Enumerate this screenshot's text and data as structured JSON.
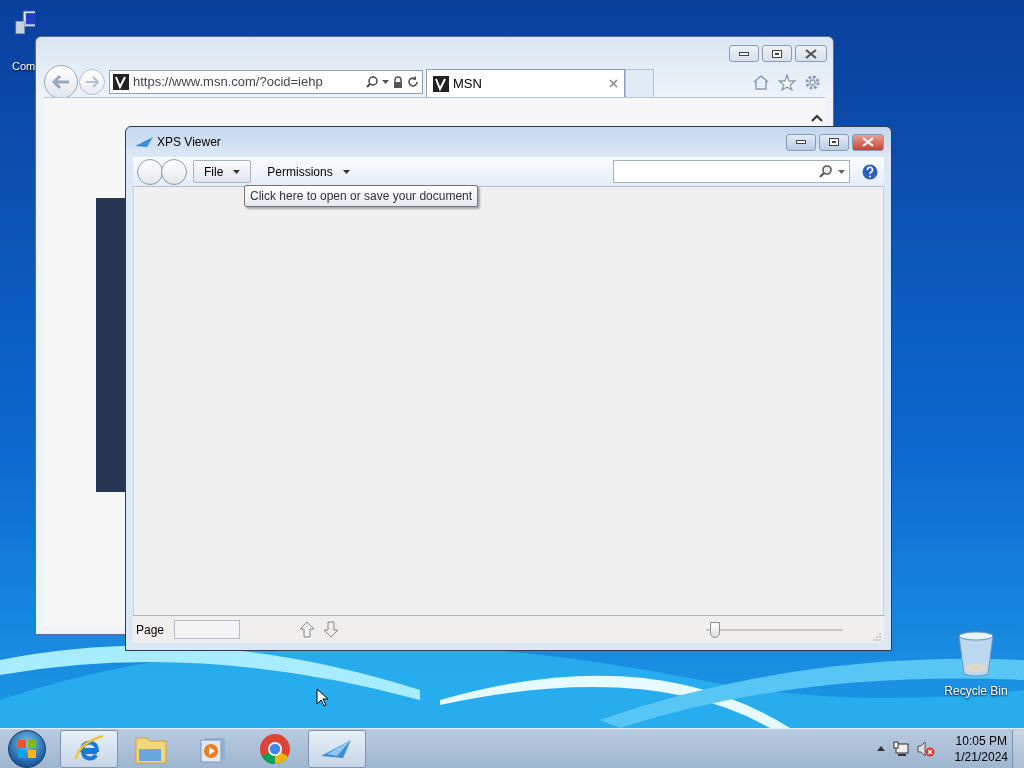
{
  "desktop_icons": [
    {
      "kind": "computer",
      "label": "Com"
    },
    {
      "kind": "recycle",
      "label": "Recycle Bin"
    }
  ],
  "browser": {
    "address": "https://www.msn.com/?ocid=iehp",
    "tabs": [
      {
        "label": "MSN",
        "selected": true
      }
    ]
  },
  "xps": {
    "title": "XPS Viewer",
    "menus": [
      {
        "label": "File",
        "kind": "button"
      },
      {
        "label": "Permissions",
        "kind": "plain"
      }
    ],
    "tooltip": "Click here to open or save your document",
    "status": {
      "page_label": "Page",
      "zoom": {
        "level": 0.03
      }
    }
  },
  "taskbar": {
    "items": [
      {
        "kind": "ie",
        "selected": true
      },
      {
        "kind": "explorer",
        "selected": false
      },
      {
        "kind": "media",
        "selected": false
      },
      {
        "kind": "chrome",
        "selected": false
      },
      {
        "kind": "xps",
        "selected": true
      }
    ],
    "clock": {
      "time": "10:05 PM",
      "date": "1/21/2024"
    }
  }
}
